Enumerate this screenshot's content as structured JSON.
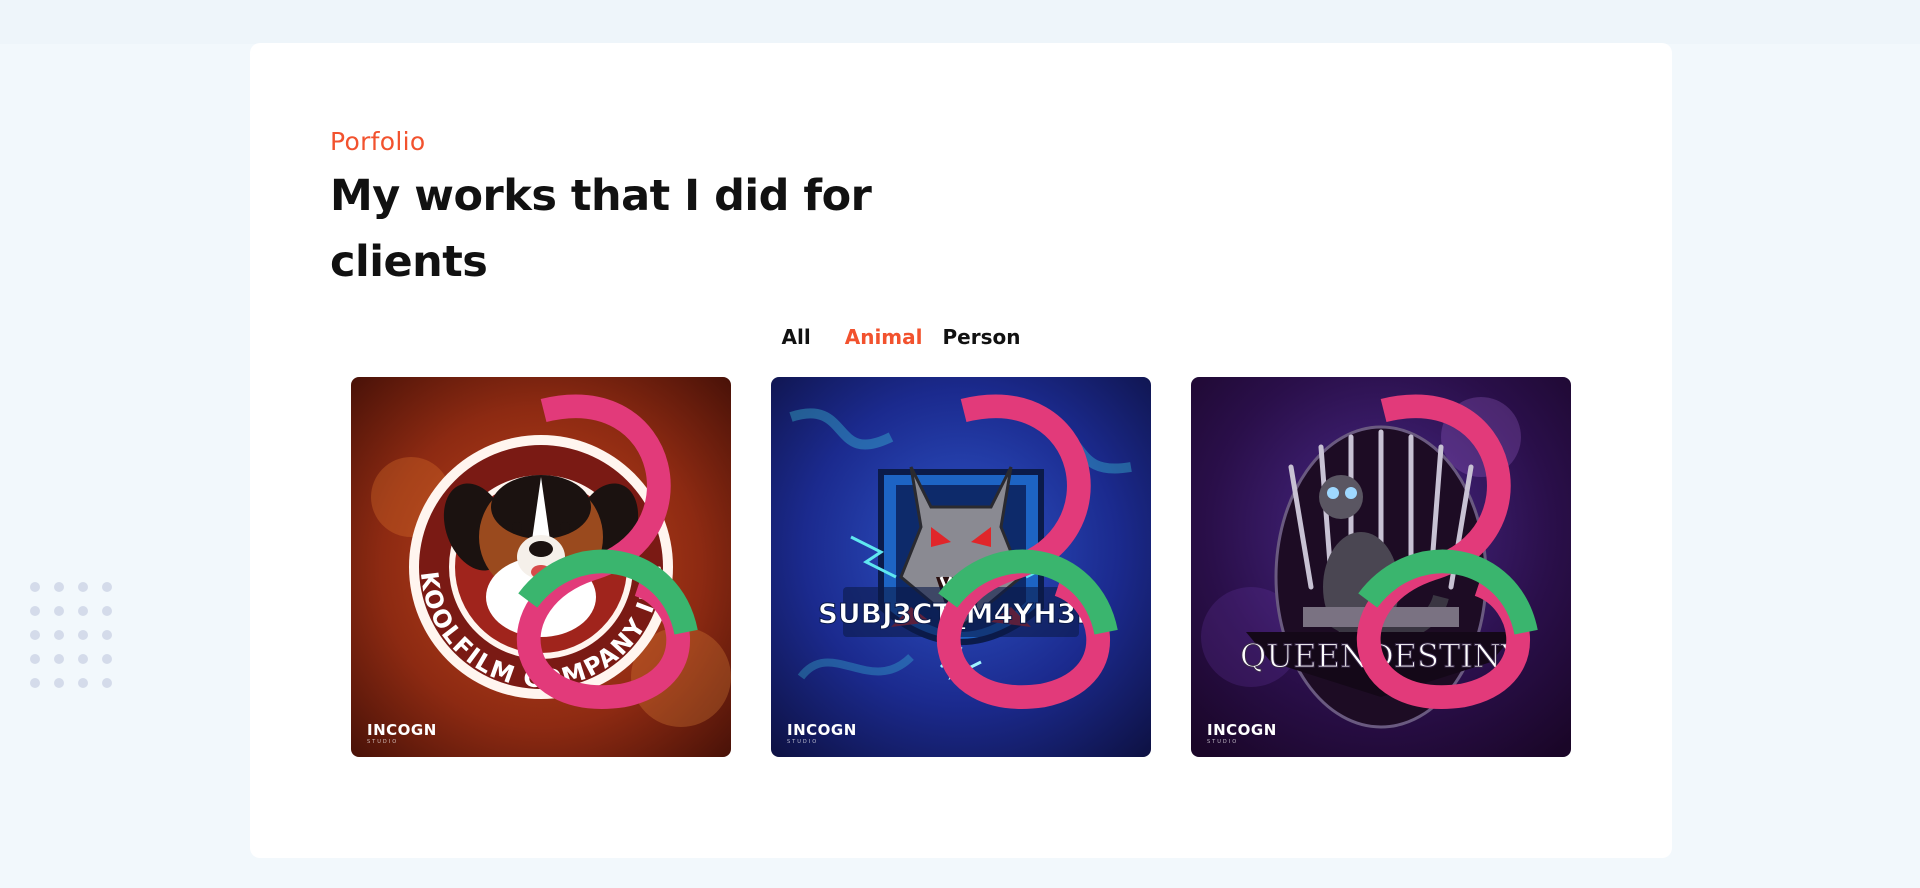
{
  "portfolio": {
    "eyebrow": "Porfolio",
    "headline": "My works that I did for clients"
  },
  "filters": [
    {
      "label": "All",
      "active": false
    },
    {
      "label": "Animal",
      "active": true
    },
    {
      "label": "Person",
      "active": false
    }
  ],
  "gallery": [
    {
      "logo_text": "AKOOLFILM COMPANY INC.",
      "watermark": "INCOGN",
      "watermark_sub": "STUDIO",
      "background": "#8a2a12"
    },
    {
      "logo_text": "SUBJ3CT_M4YH3M",
      "watermark": "INCOGN",
      "watermark_sub": "STUDIO",
      "background": "#1e2a8c"
    },
    {
      "logo_text": "QUEENDESTINY",
      "watermark": "INCOGN",
      "watermark_sub": "STUDIO",
      "background": "#2a0f4a"
    }
  ],
  "colors": {
    "accent": "#f2522e",
    "heading": "#111111",
    "page_bg": "#f2f8fc",
    "card_bg": "#ffffff"
  }
}
